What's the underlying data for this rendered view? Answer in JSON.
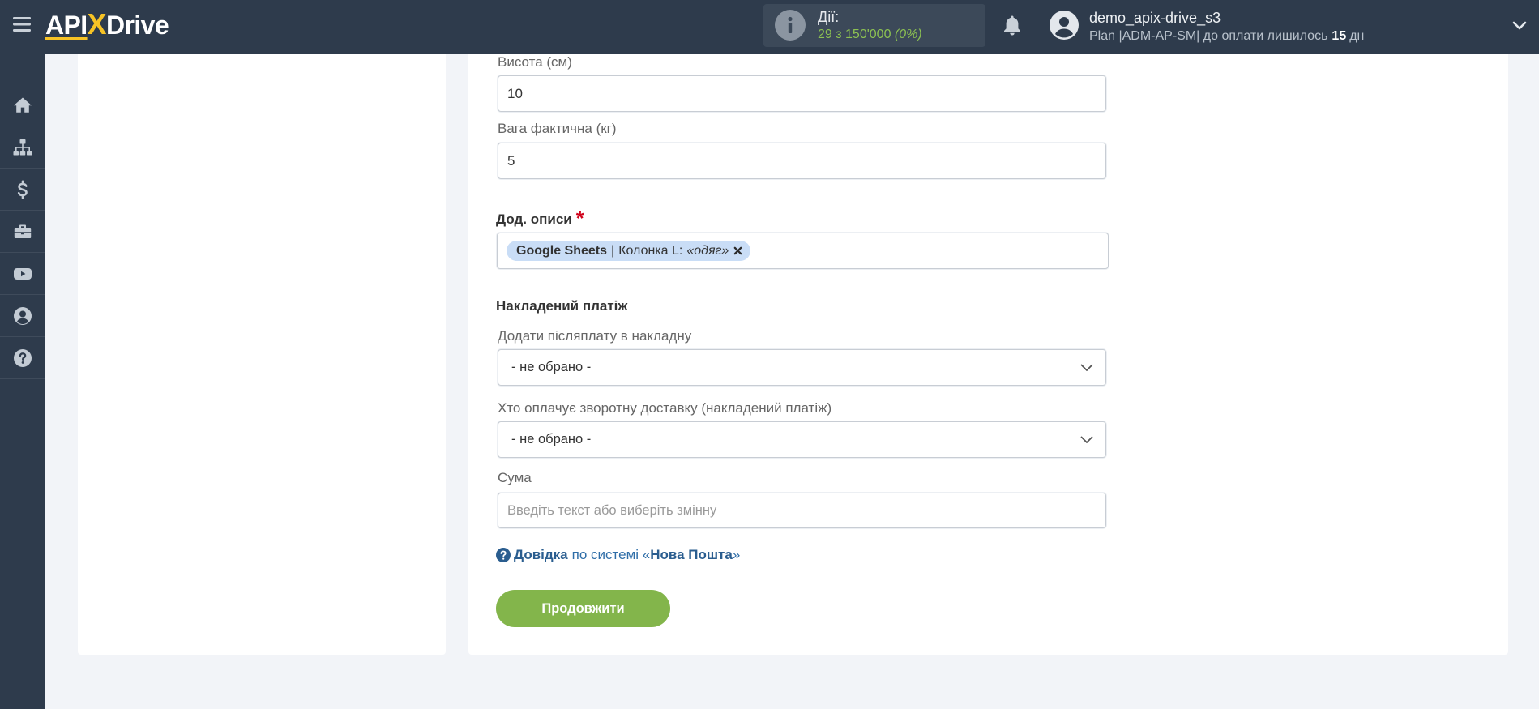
{
  "colors": {
    "header_bg": "#2e3b4c",
    "brand_yellow": "#f7c325",
    "actions_green": "#8cc152",
    "button_green": "#83b54b",
    "link_blue": "#2a5d8f",
    "required_red": "#d0021b"
  },
  "app": {
    "logo_api": "API",
    "logo_x": "X",
    "logo_drive": "Drive"
  },
  "header": {
    "icons": [
      "menu-icon",
      "info-icon",
      "bell-icon",
      "avatar-icon",
      "chevron-down-icon"
    ],
    "actions": {
      "label": "Дії:",
      "count": "29 з 150'000",
      "percent": "(0%)"
    },
    "user": {
      "name": "demo_apix-drive_s3",
      "plan": "Plan |ADM-AP-SM| до оплати лишилось",
      "days": "15",
      "days_unit": "дн"
    }
  },
  "sidebar": {
    "items": [
      {
        "icon": "home-icon"
      },
      {
        "icon": "sitemap-icon"
      },
      {
        "icon": "dollar-icon"
      },
      {
        "icon": "briefcase-icon"
      },
      {
        "icon": "youtube-icon"
      },
      {
        "icon": "user-circle-icon"
      },
      {
        "icon": "question-circle-icon"
      }
    ]
  },
  "form": {
    "height": {
      "label": "Висота (см)",
      "value": "10"
    },
    "weight": {
      "label": "Вага фактична (кг)",
      "value": "5"
    },
    "descriptions": {
      "label": "Дод. описи",
      "required_mark": "*",
      "tags": [
        {
          "source": "Google Sheets",
          "separator": "|",
          "field": "Колонка L:",
          "value": "«одяг»"
        }
      ]
    },
    "cod_section": {
      "title": "Накладений платіж",
      "add_cod": {
        "label": "Додати післяплату в накладну",
        "selected": "- не обрано -"
      },
      "return_payer": {
        "label": "Хто оплачує зворотну доставку (накладений платіж)",
        "selected": "- не обрано -"
      },
      "sum": {
        "label": "Сума",
        "value": "",
        "placeholder": "Введіть текст або виберіть змінну"
      }
    }
  },
  "help": {
    "link_label": "Довідка",
    "text_before": "по системі «",
    "system_name": "Нова Пошта",
    "text_after": "»"
  },
  "continue_button": {
    "label": "Продовжити"
  }
}
